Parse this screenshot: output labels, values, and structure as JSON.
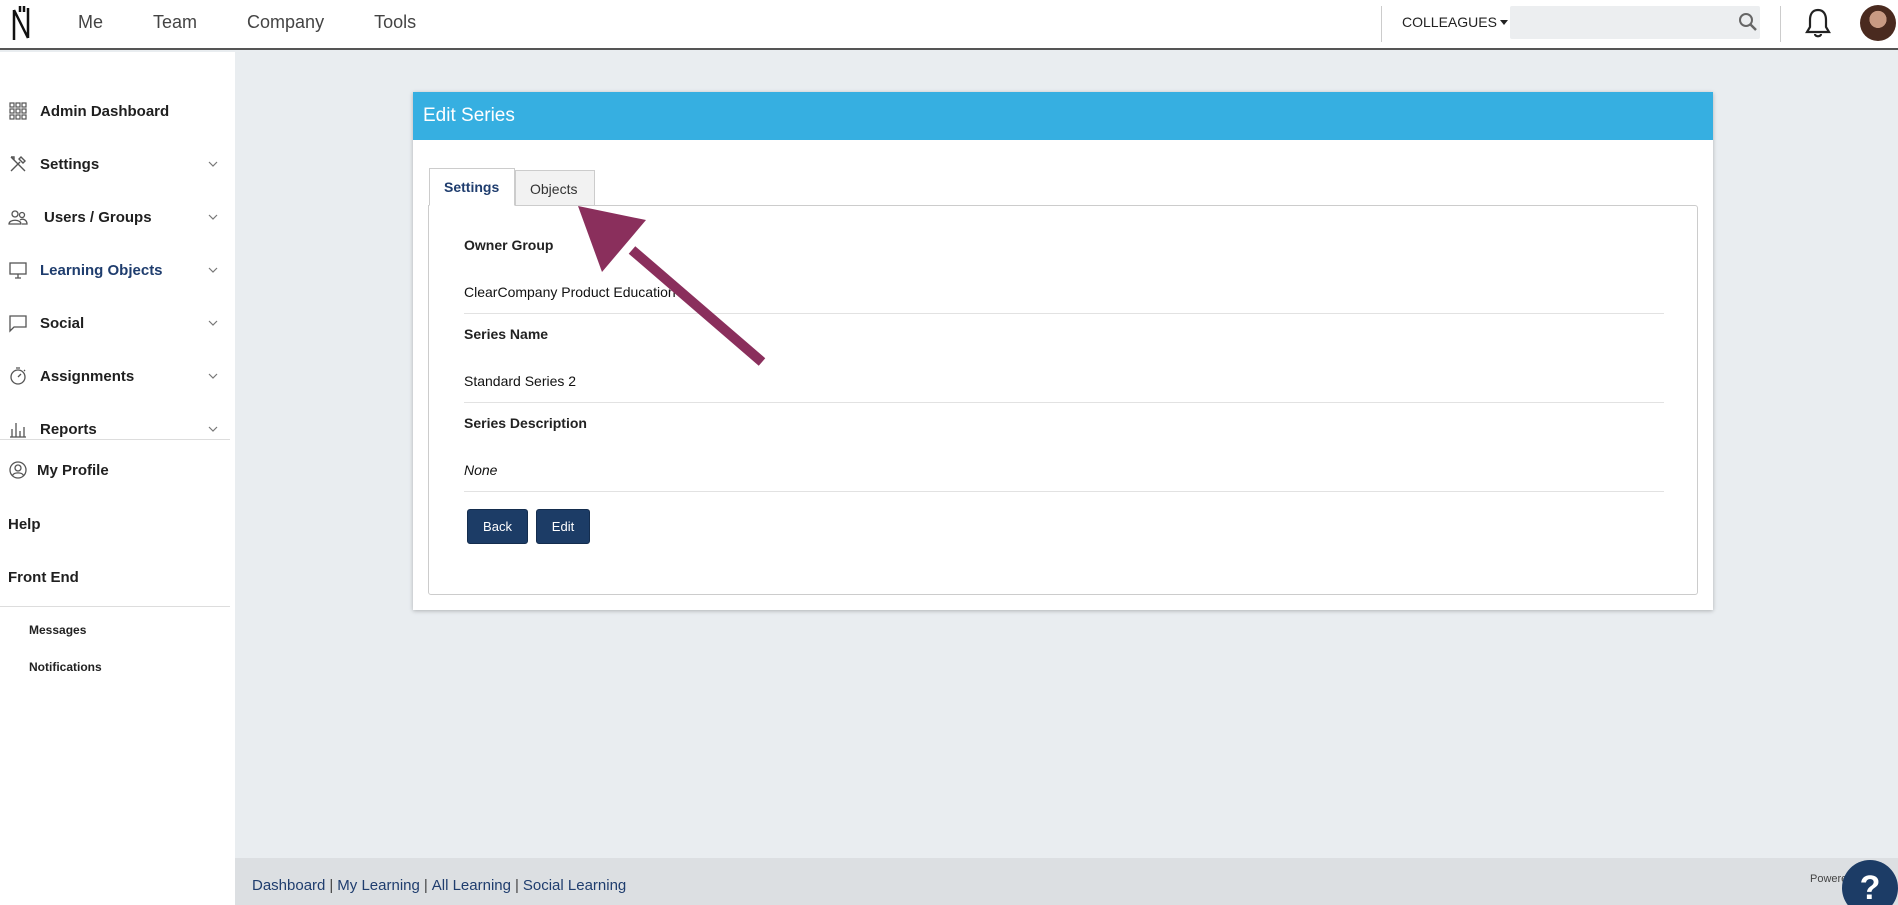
{
  "topbar": {
    "nav": [
      "Me",
      "Team",
      "Company",
      "Tools"
    ],
    "colleagues_label": "COLLEAGUES",
    "search_placeholder": ""
  },
  "sidebar": {
    "items": [
      {
        "label": "Admin Dashboard",
        "icon": "grid-icon",
        "has_chevron": false
      },
      {
        "label": "Settings",
        "icon": "tools-icon",
        "has_chevron": true
      },
      {
        "label": "Users / Groups",
        "icon": "users-icon",
        "has_chevron": true
      },
      {
        "label": "Learning Objects",
        "icon": "monitor-icon",
        "has_chevron": true
      },
      {
        "label": "Social",
        "icon": "chat-icon",
        "has_chevron": true
      },
      {
        "label": "Assignments",
        "icon": "stopwatch-icon",
        "has_chevron": true
      },
      {
        "label": "Reports",
        "icon": "bar-chart-icon",
        "has_chevron": true
      }
    ],
    "my_profile": "My Profile",
    "help": "Help",
    "front_end": "Front End",
    "messages": "Messages",
    "notifications": "Notifications"
  },
  "card": {
    "title": "Edit Series",
    "tabs": [
      "Settings",
      "Objects"
    ],
    "fields": [
      {
        "label": "Owner Group",
        "value": "ClearCompany Product Education"
      },
      {
        "label": "Series Name",
        "value": "Standard Series 2"
      },
      {
        "label": "Series Description",
        "value": "None"
      }
    ],
    "back_label": "Back",
    "edit_label": "Edit"
  },
  "footer": {
    "links": [
      "Dashboard",
      "My Learning",
      "All Learning",
      "Social Learning"
    ],
    "powered": "Powered",
    "help_glyph": "?"
  },
  "colors": {
    "header": "#36afe1",
    "primary_button": "#1c3c66",
    "arrow": "#8a2f5c"
  }
}
